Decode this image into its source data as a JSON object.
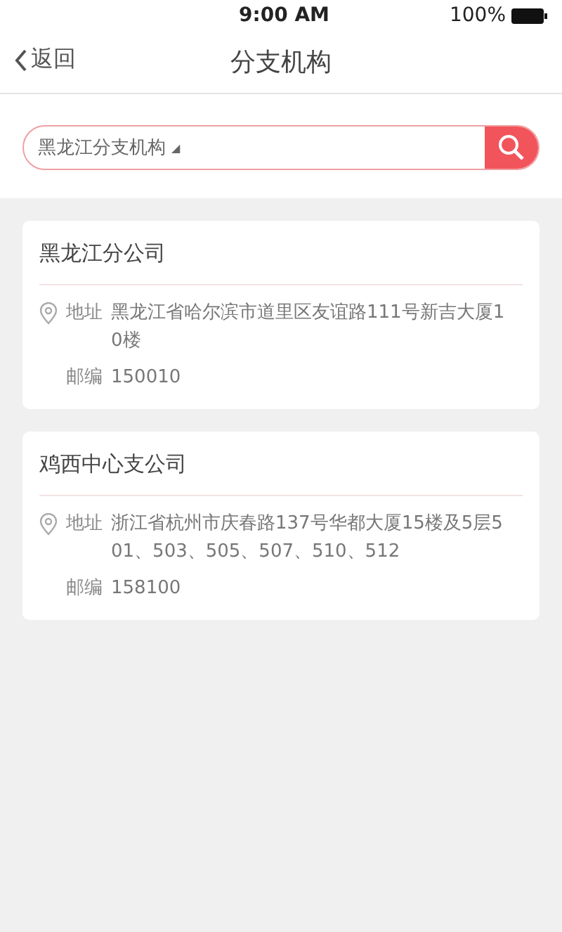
{
  "status_bar": {
    "time": "9:00 AM",
    "battery": "100%"
  },
  "nav": {
    "back": "返回",
    "title": "分支机构"
  },
  "search": {
    "value": "黑龙江分支机构",
    "caret": "◢"
  },
  "branches": [
    {
      "name": "黑龙江分公司",
      "address_label": "地址",
      "address": "黑龙江省哈尔滨市道里区友谊路111号新吉大厦10楼",
      "postcode_label": "邮编",
      "postcode": "150010"
    },
    {
      "name": "鸡西中心支公司",
      "address_label": "地址",
      "address": "浙江省杭州市庆春路137号华都大厦15楼及5层501、503、505、507、510、512",
      "postcode_label": "邮编",
      "postcode": "158100"
    }
  ]
}
